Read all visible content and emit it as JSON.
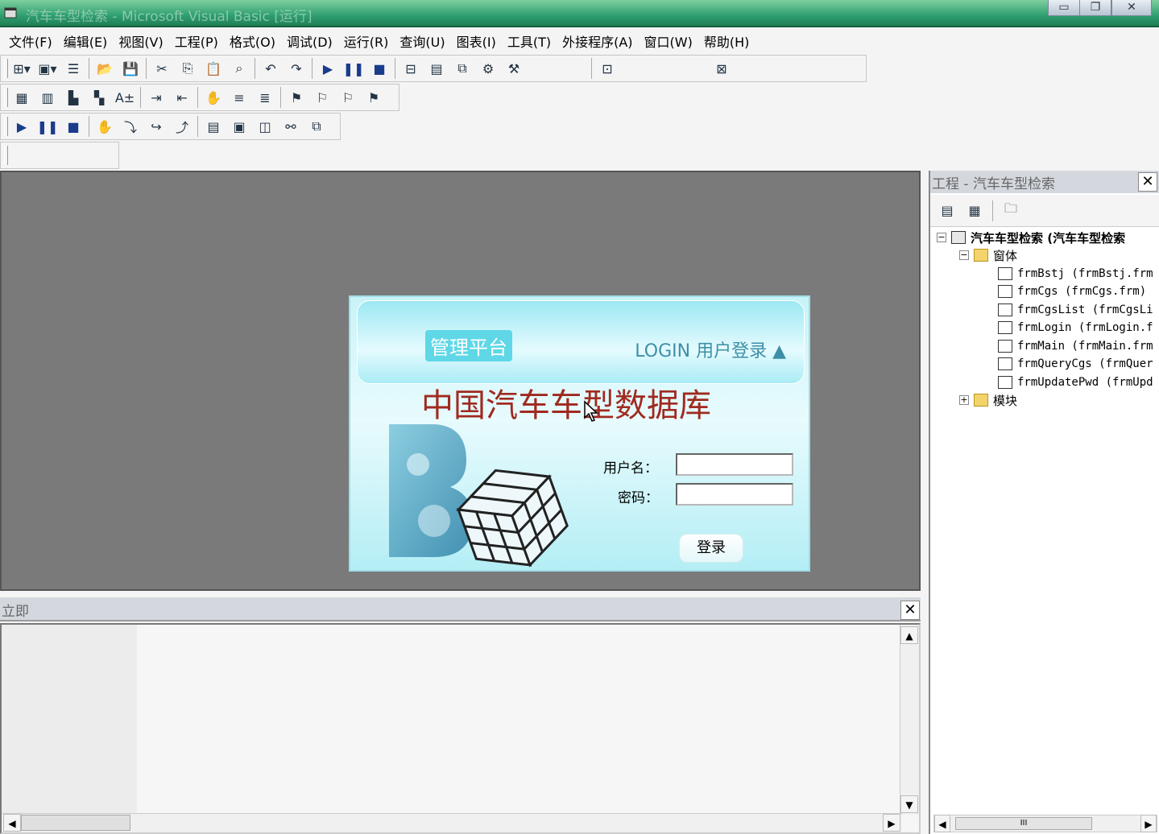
{
  "window": {
    "title": "汽车车型检索 - Microsoft Visual Basic [运行]",
    "controls": [
      "minimize-icon",
      "restore-icon",
      "close-icon"
    ]
  },
  "menu": {
    "items": [
      "文件(F)",
      "编辑(E)",
      "视图(V)",
      "工程(P)",
      "格式(O)",
      "调试(D)",
      "运行(R)",
      "查询(U)",
      "图表(I)",
      "工具(T)",
      "外接程序(A)",
      "窗口(W)",
      "帮助(H)"
    ]
  },
  "toolbars": {
    "standard": [
      "add-project-icon",
      "add-form-icon",
      "menu-editor-icon",
      "open-icon",
      "save-icon",
      "cut-icon",
      "copy-icon",
      "paste-icon",
      "find-icon",
      "undo-icon",
      "redo-icon",
      "start-icon",
      "break-icon",
      "end-icon",
      "project-explorer-icon",
      "properties-icon",
      "form-layout-icon",
      "object-browser-icon",
      "toolbox-icon",
      "position-icon",
      "size-icon"
    ],
    "edit": [
      "list-properties-icon",
      "list-constants-icon",
      "quick-info-icon",
      "parameter-info-icon",
      "complete-word-icon",
      "indent-icon",
      "outdent-icon",
      "toggle-breakpoint-icon",
      "comment-block-icon",
      "uncomment-block-icon",
      "toggle-bookmark-icon",
      "next-bookmark-icon",
      "previous-bookmark-icon",
      "clear-bookmarks-icon"
    ],
    "debug": [
      "start-icon",
      "break-icon",
      "end-icon",
      "toggle-breakpoint-icon",
      "step-into-icon",
      "step-over-icon",
      "step-out-icon",
      "locals-window-icon",
      "immediate-window-icon",
      "watch-window-icon",
      "quick-watch-icon",
      "call-stack-icon"
    ]
  },
  "login_form": {
    "badge": "管理平台",
    "login_label": "LOGIN 用户登录 ▲",
    "title": "中国汽车车型数据库",
    "username_label": "用户名：",
    "password_label": "密码：",
    "username_value": "",
    "password_value": "",
    "submit_label": "登录"
  },
  "immediate": {
    "title": "立即",
    "content": ""
  },
  "project_explorer": {
    "title": "工程 - 汽车车型检索",
    "project_node": "汽车车型检索 (汽车车型检索",
    "forms_folder": "窗体",
    "forms": [
      "frmBstj (frmBstj.frm",
      "frmCgs (frmCgs.frm)",
      "frmCgsList (frmCgsLi",
      "frmLogin (frmLogin.f",
      "frmMain (frmMain.frm",
      "frmQueryCgs (frmQuer",
      "frmUpdatePwd (frmUpd"
    ],
    "modules_folder": "模块",
    "scroll_thumb": "III"
  }
}
